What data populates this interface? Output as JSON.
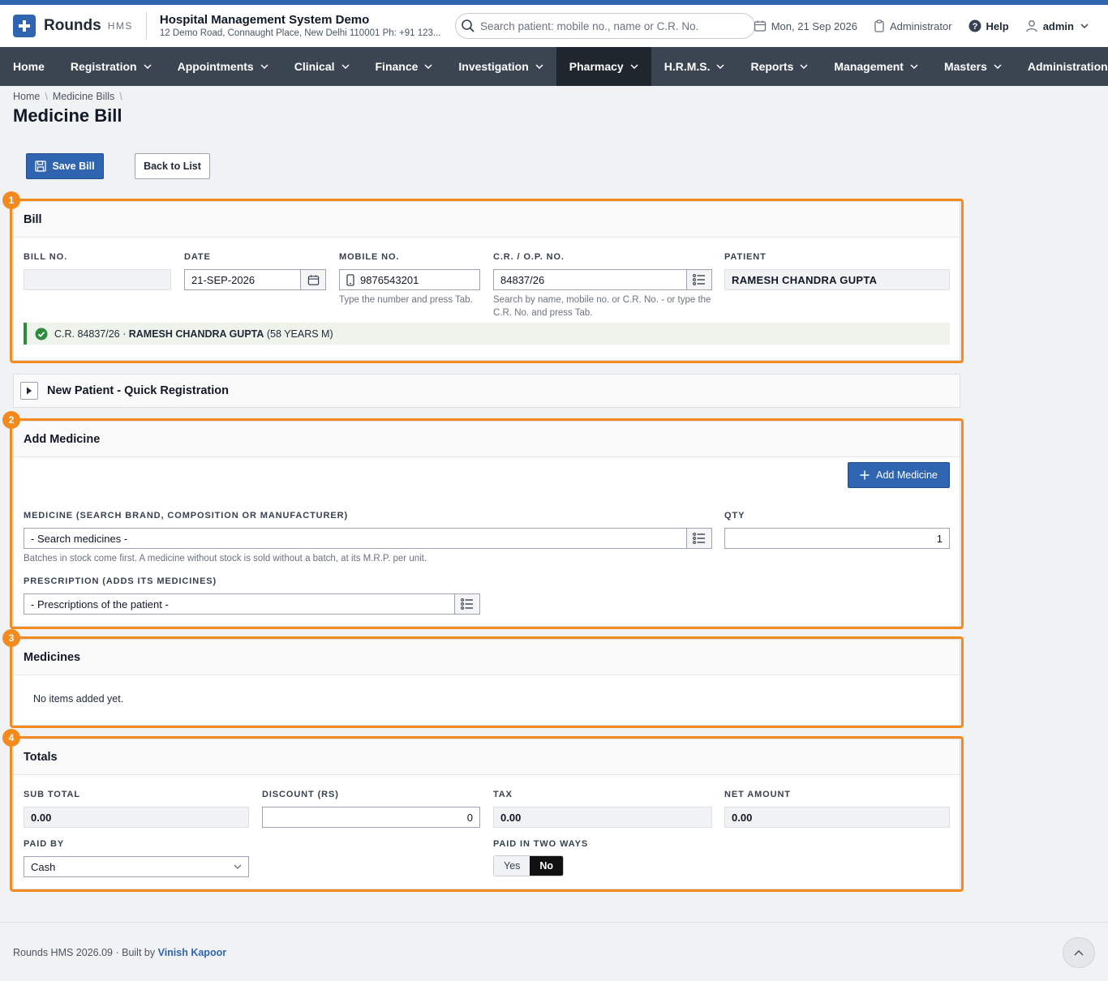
{
  "header": {
    "brand": "Rounds",
    "brand_sub": "HMS",
    "hospital_name": "Hospital Management System Demo",
    "hospital_address": "12 Demo Road, Connaught Place, New Delhi 110001 Ph: +91 123...",
    "search_placeholder": "Search patient: mobile no., name or C.R. No.",
    "date": "Mon, 21 Sep 2026",
    "role": "Administrator",
    "help": "Help",
    "user": "admin"
  },
  "nav": {
    "items": [
      {
        "label": "Home"
      },
      {
        "label": "Registration"
      },
      {
        "label": "Appointments"
      },
      {
        "label": "Clinical"
      },
      {
        "label": "Finance"
      },
      {
        "label": "Investigation"
      },
      {
        "label": "Pharmacy"
      },
      {
        "label": "H.R.M.S."
      },
      {
        "label": "Reports"
      },
      {
        "label": "Management"
      },
      {
        "label": "Masters"
      },
      {
        "label": "Administration"
      }
    ],
    "active": "Pharmacy"
  },
  "breadcrumb": {
    "home": "Home",
    "section": "Medicine Bills"
  },
  "page_title": "Medicine Bill",
  "actions": {
    "save": "Save Bill",
    "back": "Back to List"
  },
  "bill": {
    "section_number": "1",
    "title": "Bill",
    "bill_no_label": "BILL NO.",
    "bill_no_value": "",
    "date_label": "DATE",
    "date_value": "21-SEP-2026",
    "mobile_label": "MOBILE NO.",
    "mobile_value": "9876543201",
    "mobile_hint": "Type the number and press Tab.",
    "cr_label": "C.R. / O.P. NO.",
    "cr_value": "84837/26",
    "cr_hint": "Search by name, mobile no. or C.R. No. - or type the C.R. No. and press Tab.",
    "patient_label": "PATIENT",
    "patient_value": "RAMESH CHANDRA GUPTA",
    "confirm_prefix": "C.R. 84837/26 ·",
    "confirm_name": "RAMESH CHANDRA GUPTA",
    "confirm_suffix": "(58 YEARS M)"
  },
  "quick_registration": {
    "title": "New Patient - Quick Registration"
  },
  "add_medicine": {
    "section_number": "2",
    "title": "Add Medicine",
    "add_button": "Add Medicine",
    "medicine_label": "MEDICINE (SEARCH BRAND, COMPOSITION OR MANUFACTURER)",
    "medicine_placeholder": "- Search medicines -",
    "medicine_hint": "Batches in stock come first. A medicine without stock is sold without a batch, at its M.R.P. per unit.",
    "qty_label": "QTY",
    "qty_value": "1",
    "prescription_label": "PRESCRIPTION (ADDS ITS MEDICINES)",
    "prescription_placeholder": "- Prescriptions of the patient -"
  },
  "medicines": {
    "section_number": "3",
    "title": "Medicines",
    "empty": "No items added yet."
  },
  "totals": {
    "section_number": "4",
    "title": "Totals",
    "sub_total_label": "SUB TOTAL",
    "sub_total_value": "0.00",
    "discount_label": "DISCOUNT (RS)",
    "discount_value": "0",
    "tax_label": "TAX",
    "tax_value": "0.00",
    "net_label": "NET AMOUNT",
    "net_value": "0.00",
    "paid_by_label": "PAID BY",
    "paid_by_value": "Cash",
    "two_ways_label": "PAID IN TWO WAYS",
    "yes": "Yes",
    "no": "No",
    "two_ways_selected": "No"
  },
  "footer": {
    "text": "Rounds HMS 2026.09 · Built by",
    "author": "Vinish Kapoor"
  },
  "colors": {
    "primary": "#2f64b0",
    "nav_bg": "#3b4551",
    "nav_active": "#1f262e",
    "highlight": "#f28a1e",
    "success": "#2e8b3e"
  },
  "icons": [
    "plus-icon",
    "search-icon",
    "calendar-icon",
    "clipboard-icon",
    "help-icon",
    "user-icon",
    "chevron-down-icon",
    "save-icon",
    "phone-icon",
    "list-icon",
    "check-circle-icon",
    "caret-right-icon",
    "chevron-up-icon"
  ]
}
